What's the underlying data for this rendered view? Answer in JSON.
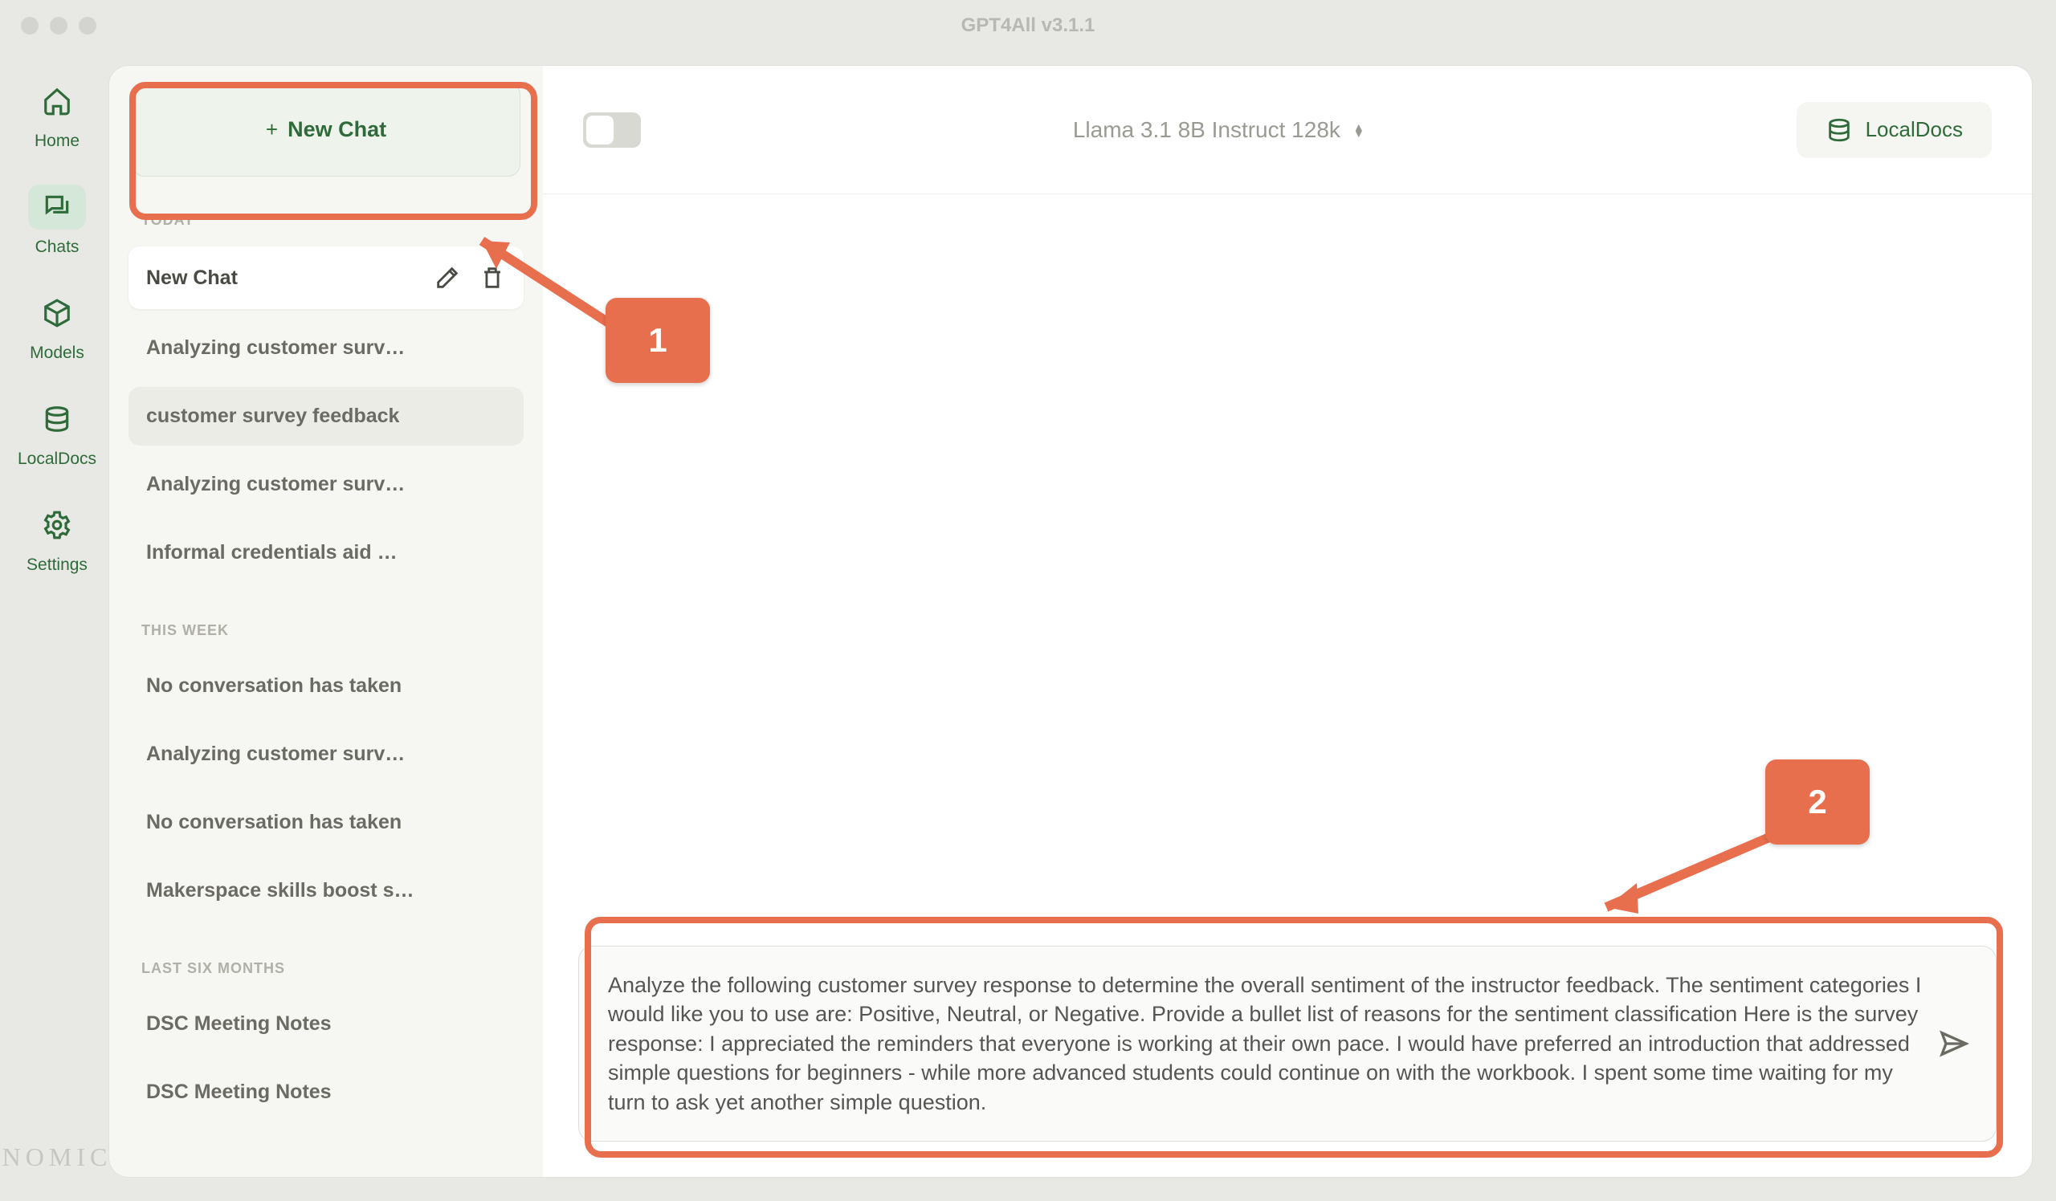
{
  "window": {
    "title": "GPT4All v3.1.1"
  },
  "rail": {
    "items": [
      {
        "label": "Home"
      },
      {
        "label": "Chats"
      },
      {
        "label": "Models"
      },
      {
        "label": "LocalDocs"
      },
      {
        "label": "Settings"
      }
    ],
    "logo": "NOMIC"
  },
  "sidebar": {
    "new_chat_label": "New Chat",
    "sections": [
      {
        "label": "TODAY",
        "items": [
          {
            "title": "New Chat",
            "selected": true
          },
          {
            "title": "Analyzing customer surv…"
          },
          {
            "title": "customer survey feedback",
            "hover": true
          },
          {
            "title": "Analyzing customer surv…"
          },
          {
            "title": "Informal credentials aid …"
          }
        ]
      },
      {
        "label": "THIS WEEK",
        "items": [
          {
            "title": "No conversation has taken"
          },
          {
            "title": "Analyzing customer surv…"
          },
          {
            "title": "No conversation has taken"
          },
          {
            "title": "Makerspace skills boost s…"
          }
        ]
      },
      {
        "label": "LAST SIX MONTHS",
        "items": [
          {
            "title": "DSC Meeting Notes"
          },
          {
            "title": "DSC Meeting Notes"
          }
        ]
      }
    ]
  },
  "chat_header": {
    "model": "Llama 3.1 8B Instruct 128k",
    "localdocs_label": "LocalDocs"
  },
  "input": {
    "text": "Analyze the following customer survey response to determine the overall sentiment of the instructor feedback. The sentiment categories I would like you to use are: Positive, Neutral, or Negative. Provide a bullet list of reasons for the sentiment classification Here is the survey response: I appreciated the reminders that everyone is working at their own pace. I would have preferred an introduction that addressed simple questions for beginners - while more advanced students could continue on with the workbook. I spent some time waiting for my turn to ask yet another simple question."
  },
  "annotations": {
    "badge1": "1",
    "badge2": "2"
  }
}
